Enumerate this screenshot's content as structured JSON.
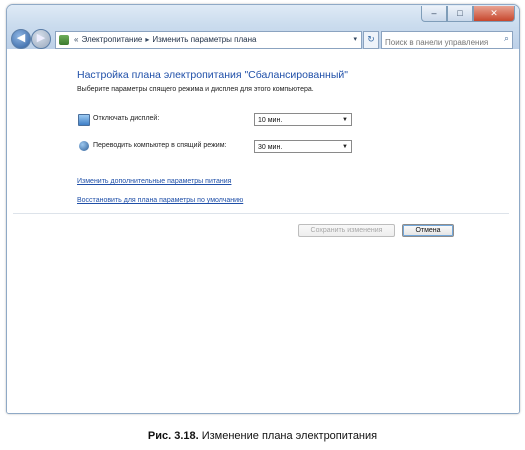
{
  "window_controls": {
    "minimize": "–",
    "maximize": "□",
    "close": "✕"
  },
  "nav": {
    "back": "◀",
    "forward": "▶"
  },
  "address": {
    "icon": "control-panel-icon",
    "separator": "«",
    "crumbs": [
      "Электропитание",
      "Изменить параметры плана"
    ],
    "crumb_separator": "▸",
    "dropdown": "▾"
  },
  "refresh": "↻",
  "search": {
    "placeholder": "Поиск в панели управления",
    "icon": "search-icon",
    "glyph": "⌕"
  },
  "main": {
    "heading": "Настройка плана электропитания \"Сбалансированный\"",
    "subtext": "Выберите параметры спящего режима и дисплея для этого компьютера.",
    "settings": [
      {
        "icon": "monitor-icon",
        "label": "Отключать дисплей:",
        "value": "10 мин."
      },
      {
        "icon": "sleep-moon-icon",
        "label": "Переводить компьютер в спящий режим:",
        "value": "30 мин."
      }
    ],
    "links": [
      "Изменить дополнительные параметры питания",
      "Восстановить для плана параметры по умолчанию"
    ],
    "buttons": {
      "save": "Сохранить изменения",
      "cancel": "Отмена"
    }
  },
  "caption": {
    "prefix": "Рис. 3.18.",
    "text": " Изменение плана электропитания"
  }
}
